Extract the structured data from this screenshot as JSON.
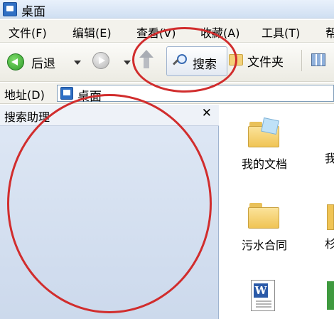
{
  "window": {
    "title": "桌面"
  },
  "menu": {
    "items": [
      "文件(F)",
      "编辑(E)",
      "查看(V)",
      "收藏(A)",
      "工具(T)",
      "帮"
    ]
  },
  "toolbar": {
    "back_label": "后退",
    "search_label": "搜索",
    "folders_label": "文件夹"
  },
  "address": {
    "label": "地址(D)",
    "value": "桌面"
  },
  "search_pane": {
    "title": "搜索助理",
    "close_glyph": "✕"
  },
  "desktop_items": [
    {
      "label": "我的文档",
      "icon": "my-documents-folder-icon"
    },
    {
      "label": "污水合同",
      "icon": "folder-icon"
    },
    {
      "label": "",
      "icon": "word-document-icon"
    }
  ],
  "partial_column": {
    "item1_char": "我",
    "item2_char": "杉"
  },
  "annotations": {
    "circle_color": "#d12d2d"
  },
  "colors": {
    "pane_bg": "#d6e1f0",
    "titlebar": "#dbe7f6",
    "accent_blue": "#2f6fc4"
  }
}
